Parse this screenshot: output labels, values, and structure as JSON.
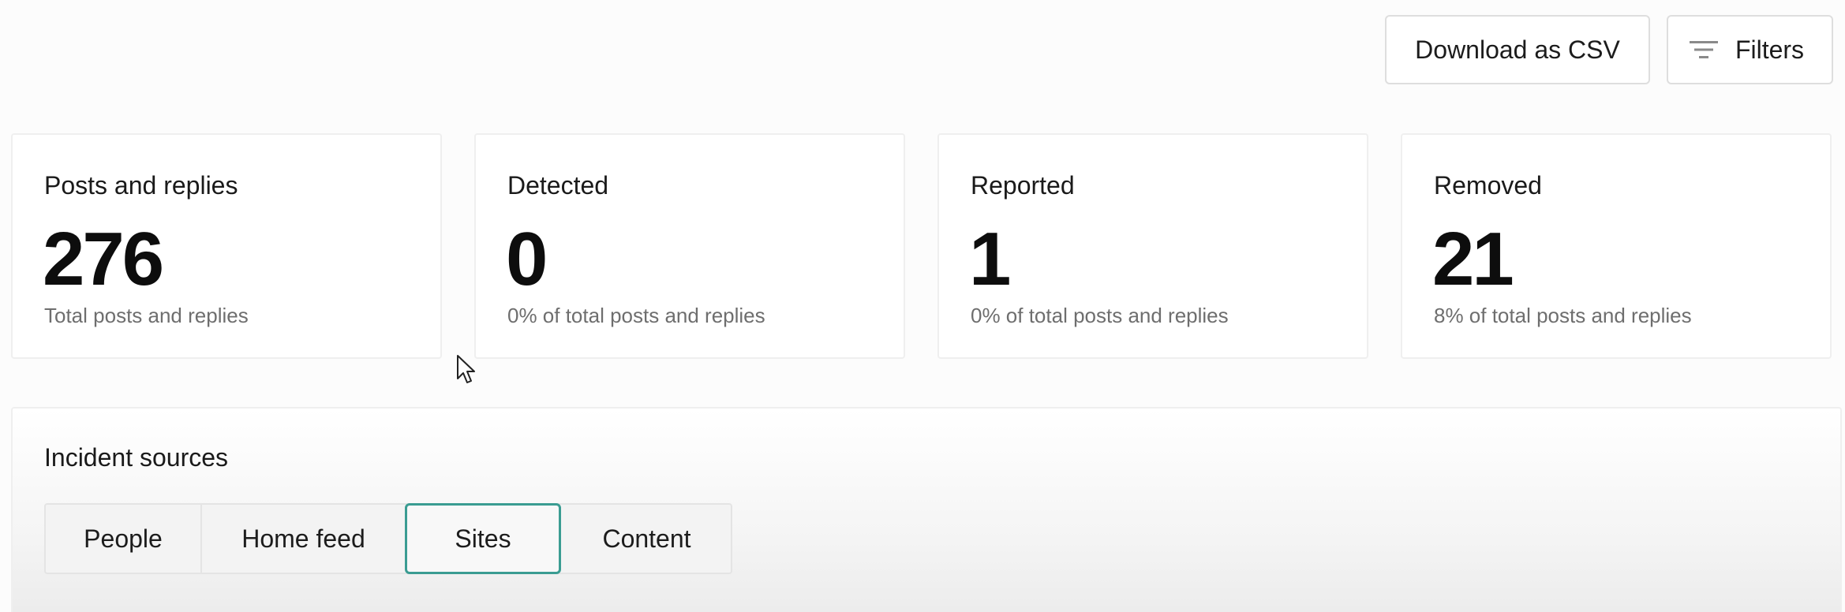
{
  "toolbar": {
    "download_label": "Download as CSV",
    "filters_label": "Filters",
    "filters_icon": "filter-lines-icon"
  },
  "stats": [
    {
      "title": "Posts and replies",
      "value": "276",
      "subtitle": "Total posts and replies"
    },
    {
      "title": "Detected",
      "value": "0",
      "subtitle": "0% of total posts and replies"
    },
    {
      "title": "Reported",
      "value": "1",
      "subtitle": "0% of total posts and replies"
    },
    {
      "title": "Removed",
      "value": "21",
      "subtitle": "8% of total posts and replies"
    }
  ],
  "incident_sources": {
    "title": "Incident sources",
    "tabs": [
      {
        "label": "People",
        "selected": false
      },
      {
        "label": "Home feed",
        "selected": false
      },
      {
        "label": "Sites",
        "selected": true
      },
      {
        "label": "Content",
        "selected": false
      }
    ]
  },
  "colors": {
    "selected_tab_border": "#3a9c92",
    "subtitle_text": "#6e6e6e"
  }
}
